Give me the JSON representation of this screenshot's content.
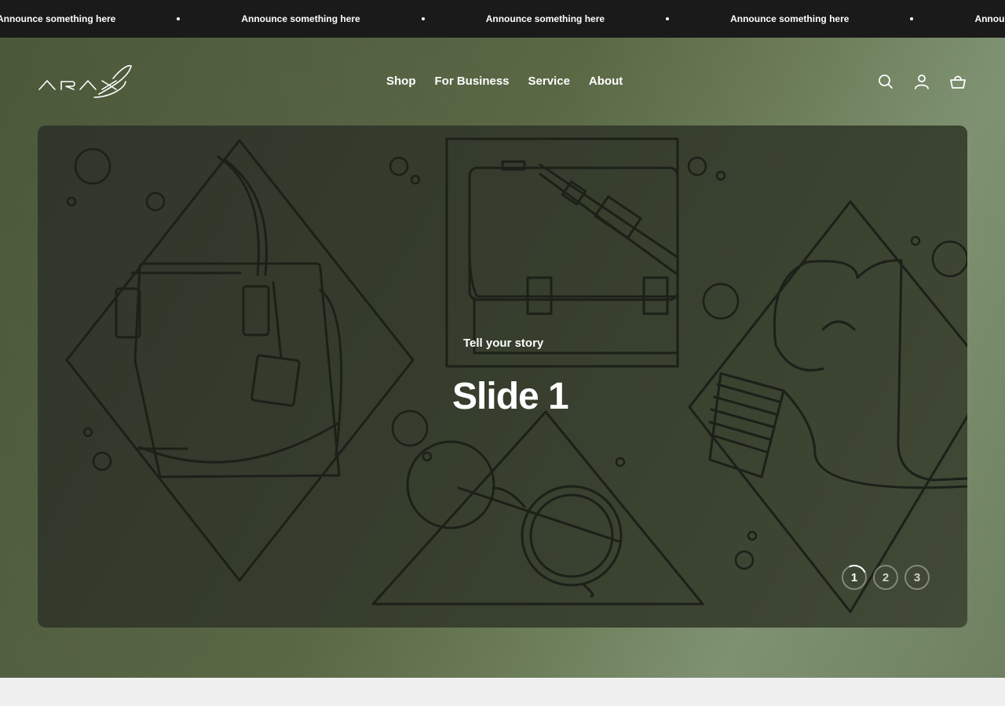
{
  "announcement": {
    "items": [
      "Announce something here",
      "Announce something here",
      "Announce something here",
      "Announce something here",
      "Announce something here"
    ],
    "bg_color": "#1a1a1a",
    "text_color": "#ffffff"
  },
  "header": {
    "logo_name": "arax-logo",
    "nav": [
      {
        "label": "Shop"
      },
      {
        "label": "For Business"
      },
      {
        "label": "Service"
      },
      {
        "label": "About"
      }
    ],
    "icons": [
      "search-icon",
      "account-icon",
      "cart-icon"
    ]
  },
  "slideshow": {
    "current": {
      "subtitle": "Tell your story",
      "title": "Slide 1"
    },
    "pager": [
      {
        "label": "1",
        "active": true
      },
      {
        "label": "2",
        "active": false
      },
      {
        "label": "3",
        "active": false
      }
    ]
  },
  "colors": {
    "accent": "#ffffff",
    "hero_gradient_start": "#4a5838",
    "hero_gradient_end": "#7f9372",
    "slide_bg": "#353c2d"
  }
}
